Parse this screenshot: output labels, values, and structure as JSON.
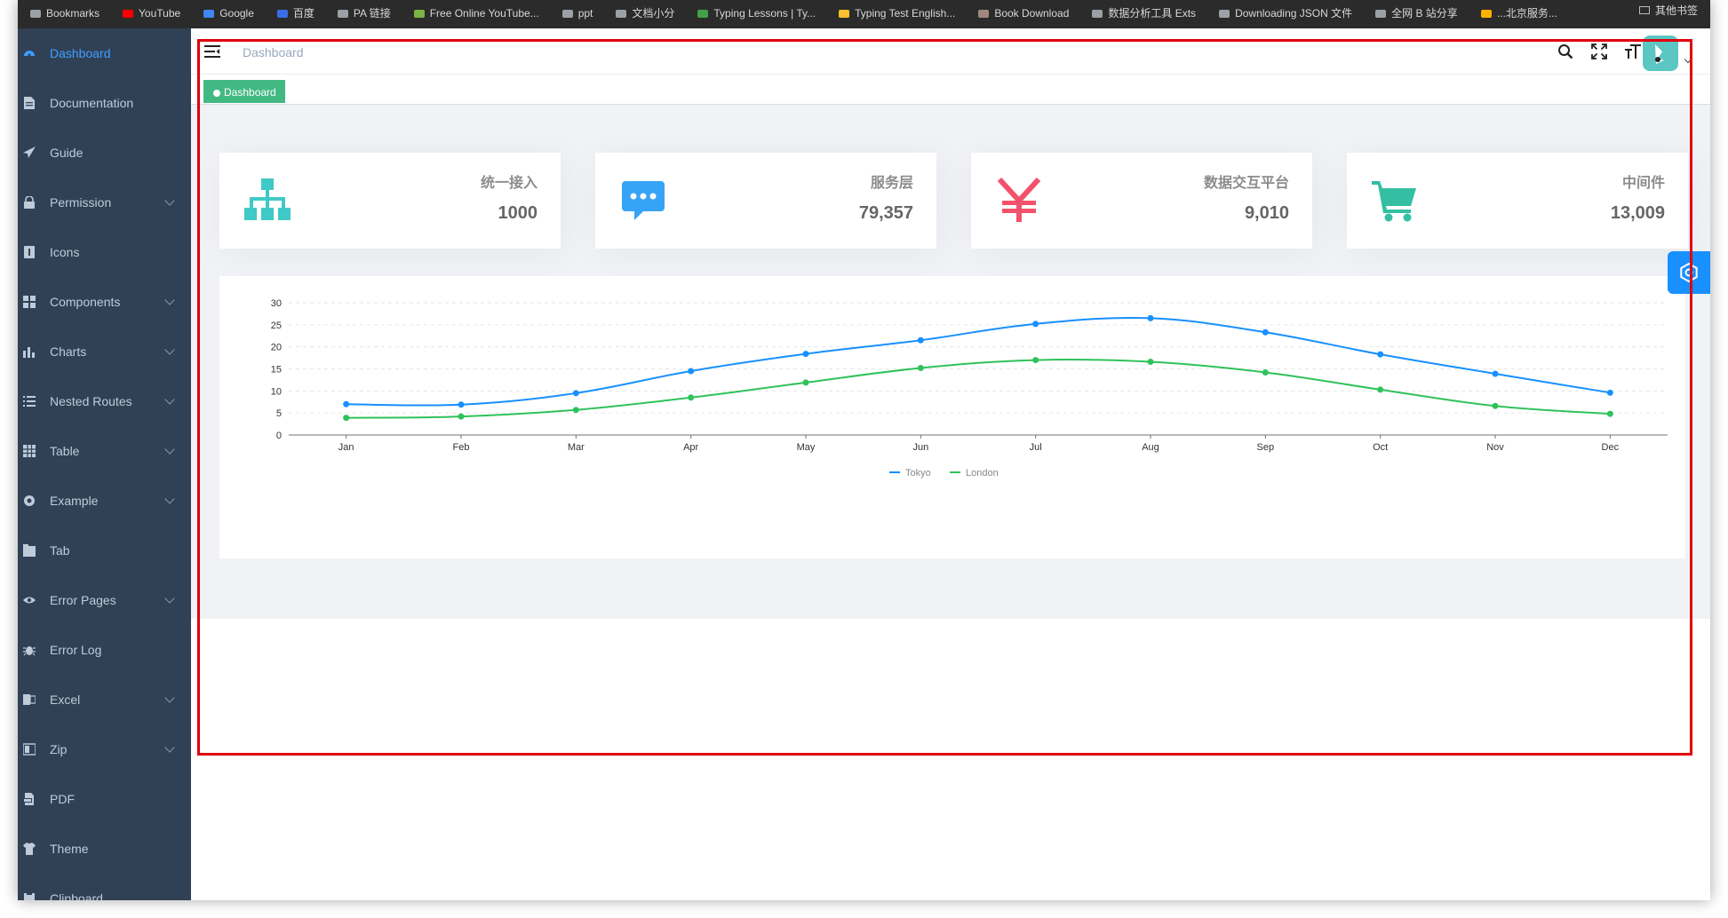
{
  "bookmarks": [
    "Bookmarks",
    "YouTube",
    "Google",
    "百度",
    "PA 链接",
    "Free Online YouTube...",
    "ppt",
    "文档小分",
    "Typing Lessons | Ty...",
    "Typing Test English...",
    "Book Download",
    "数据分析工具 Exts",
    "Downloading JSON 文件",
    "全网 B 站分享",
    "...北京服务..."
  ],
  "bookmarks_right": "其他书签",
  "sidebar": {
    "items": [
      {
        "label": "Dashboard",
        "icon": "dashboard-icon",
        "active": true,
        "arrow": false
      },
      {
        "label": "Documentation",
        "icon": "document-icon",
        "arrow": false
      },
      {
        "label": "Guide",
        "icon": "paper-plane-icon",
        "arrow": false
      },
      {
        "label": "Permission",
        "icon": "lock-icon",
        "arrow": true
      },
      {
        "label": "Icons",
        "icon": "icon-icon",
        "arrow": false
      },
      {
        "label": "Components",
        "icon": "grid-icon",
        "arrow": true
      },
      {
        "label": "Charts",
        "icon": "bar-chart-icon",
        "arrow": true
      },
      {
        "label": "Nested Routes",
        "icon": "list-icon",
        "arrow": true
      },
      {
        "label": "Table",
        "icon": "table-icon",
        "arrow": true
      },
      {
        "label": "Example",
        "icon": "settings-icon",
        "arrow": true
      },
      {
        "label": "Tab",
        "icon": "tab-icon",
        "arrow": false
      },
      {
        "label": "Error Pages",
        "icon": "eye-icon",
        "arrow": true
      },
      {
        "label": "Error Log",
        "icon": "bug-icon",
        "arrow": false
      },
      {
        "label": "Excel",
        "icon": "excel-icon",
        "arrow": true
      },
      {
        "label": "Zip",
        "icon": "zip-icon",
        "arrow": true
      },
      {
        "label": "PDF",
        "icon": "pdf-icon",
        "arrow": false
      },
      {
        "label": "Theme",
        "icon": "shirt-icon",
        "arrow": false
      },
      {
        "label": "Clipboard",
        "icon": "clipboard-icon",
        "arrow": false
      }
    ]
  },
  "navbar": {
    "breadcrumb": "Dashboard",
    "icons": [
      "search-icon",
      "fullscreen-icon",
      "font-size-icon"
    ]
  },
  "tags": [
    {
      "label": "Dashboard",
      "active": true
    }
  ],
  "cards": [
    {
      "label": "统一接入",
      "value": "1000",
      "icon": "org-chart-icon",
      "color": "#40c9c6"
    },
    {
      "label": "服务层",
      "value": "79,357",
      "icon": "message-icon",
      "color": "#36a3f7"
    },
    {
      "label": "数据交互平台",
      "value": "9,010",
      "icon": "yen-icon",
      "color": "#f4516c"
    },
    {
      "label": "中间件",
      "value": "13,009",
      "icon": "shopping-cart-icon",
      "color": "#34bfa3"
    }
  ],
  "chart_data": {
    "type": "line",
    "categories": [
      "Jan",
      "Feb",
      "Mar",
      "Apr",
      "May",
      "Jun",
      "Jul",
      "Aug",
      "Sep",
      "Oct",
      "Nov",
      "Dec"
    ],
    "series": [
      {
        "name": "Tokyo",
        "color": "#1890ff",
        "values": [
          7.0,
          6.9,
          9.5,
          14.5,
          18.4,
          21.5,
          25.2,
          26.5,
          23.3,
          18.3,
          13.9,
          9.6
        ]
      },
      {
        "name": "London",
        "color": "#2fc25b",
        "values": [
          3.9,
          4.2,
          5.7,
          8.5,
          11.9,
          15.2,
          17.0,
          16.6,
          14.2,
          10.3,
          6.6,
          4.8
        ]
      }
    ],
    "yticks": [
      0,
      5,
      10,
      15,
      20,
      25,
      30
    ],
    "ylim": [
      0,
      30
    ],
    "grid": true,
    "legend": "bottom-center"
  }
}
